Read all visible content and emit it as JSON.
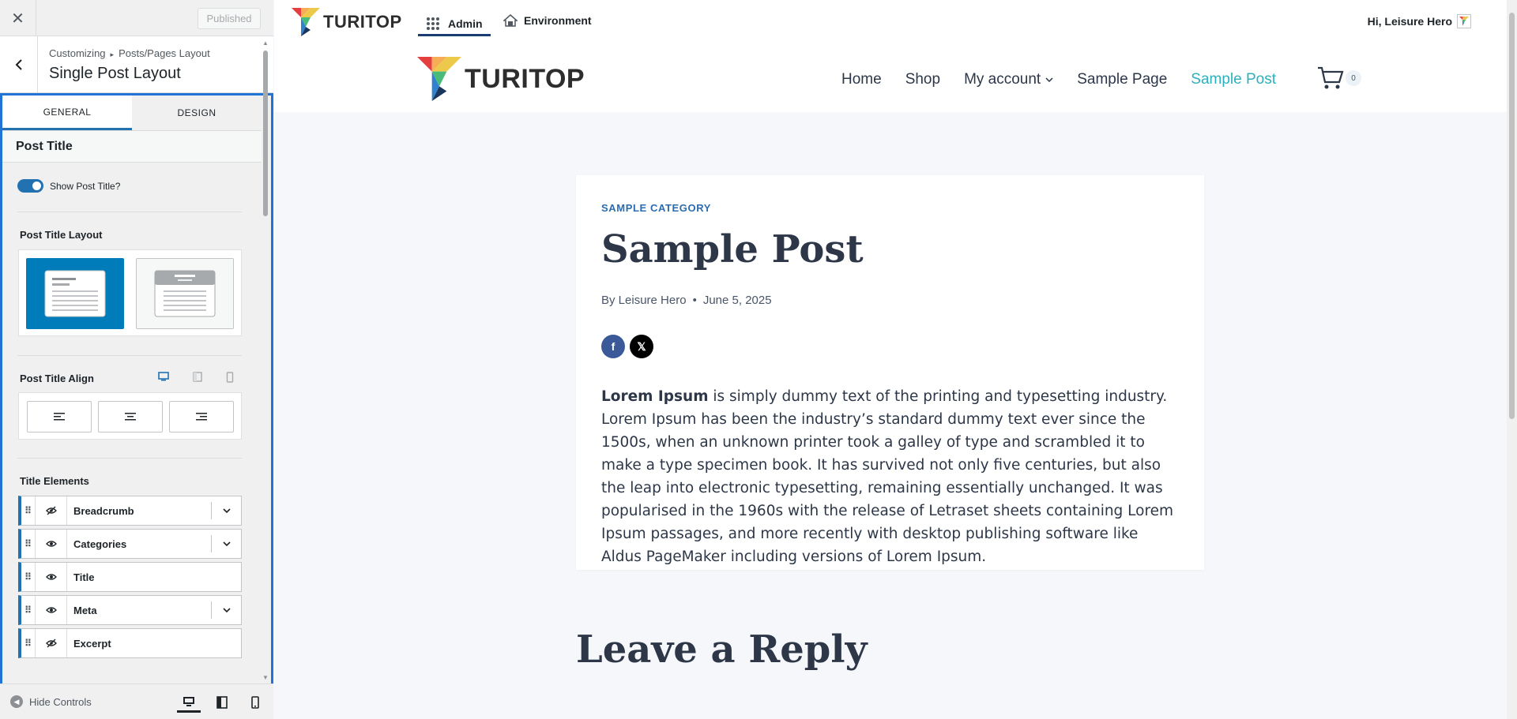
{
  "sidebar": {
    "header": {
      "close_icon": "close-icon",
      "publish_label": "Published"
    },
    "breadcrumb": {
      "root": "Customizing",
      "parent": "Posts/Pages Layout"
    },
    "section_title": "Single Post Layout",
    "tabs": [
      {
        "label": "General",
        "active": true
      },
      {
        "label": "Design",
        "active": false
      }
    ],
    "group_title": "Post Title",
    "show_title": {
      "label": "Show Post Title?",
      "on": true
    },
    "layout": {
      "label": "Post Title Layout",
      "selected": "normal"
    },
    "align": {
      "label": "Post Title Align",
      "options": [
        "left",
        "center",
        "right"
      ]
    },
    "elements": {
      "label": "Title Elements",
      "items": [
        {
          "name": "Breadcrumb",
          "visible": false,
          "expandable": true
        },
        {
          "name": "Categories",
          "visible": true,
          "expandable": true
        },
        {
          "name": "Title",
          "visible": true,
          "expandable": false
        },
        {
          "name": "Meta",
          "visible": true,
          "expandable": true
        },
        {
          "name": "Excerpt",
          "visible": false,
          "expandable": false
        }
      ]
    },
    "footer": {
      "hide_label": "Hide Controls",
      "active_device": "desktop"
    }
  },
  "adminbar": {
    "logo_text": "TURITOP",
    "admin_label": "Admin",
    "env_label": "Environment",
    "greeting": "Hi, Leisure Hero"
  },
  "site": {
    "logo_text": "TURITOP",
    "nav": [
      {
        "label": "Home",
        "active": false
      },
      {
        "label": "Shop",
        "active": false
      },
      {
        "label": "My account",
        "active": false,
        "dropdown": true
      },
      {
        "label": "Sample Page",
        "active": false
      },
      {
        "label": "Sample Post",
        "active": true
      }
    ],
    "cart_count": "0"
  },
  "post": {
    "category": "SAMPLE CATEGORY",
    "title": "Sample Post",
    "author": "By Leisure Hero",
    "date": "June 5, 2025",
    "body_bold": "Lorem Ipsum",
    "body_rest": " is simply dummy text of the printing and typesetting industry. Lorem Ipsum has been the industry’s standard dummy text ever since the 1500s, when an unknown printer took a galley of type and scrambled it to make a type specimen book. It has survived not only five centuries, but also the leap into electronic typesetting, remaining essentially unchanged. It was popularised in the 1960s with the release of Letraset sheets containing Lorem Ipsum passages, and more recently with desktop publishing software like Aldus PageMaker including versions of Lorem Ipsum.",
    "reply_title": "Leave a Reply"
  },
  "colors": {
    "accent": "#2271b1",
    "panel_border": "#1f74d6",
    "nav_active": "#2cb1bc",
    "category": "#2b6cb0"
  }
}
